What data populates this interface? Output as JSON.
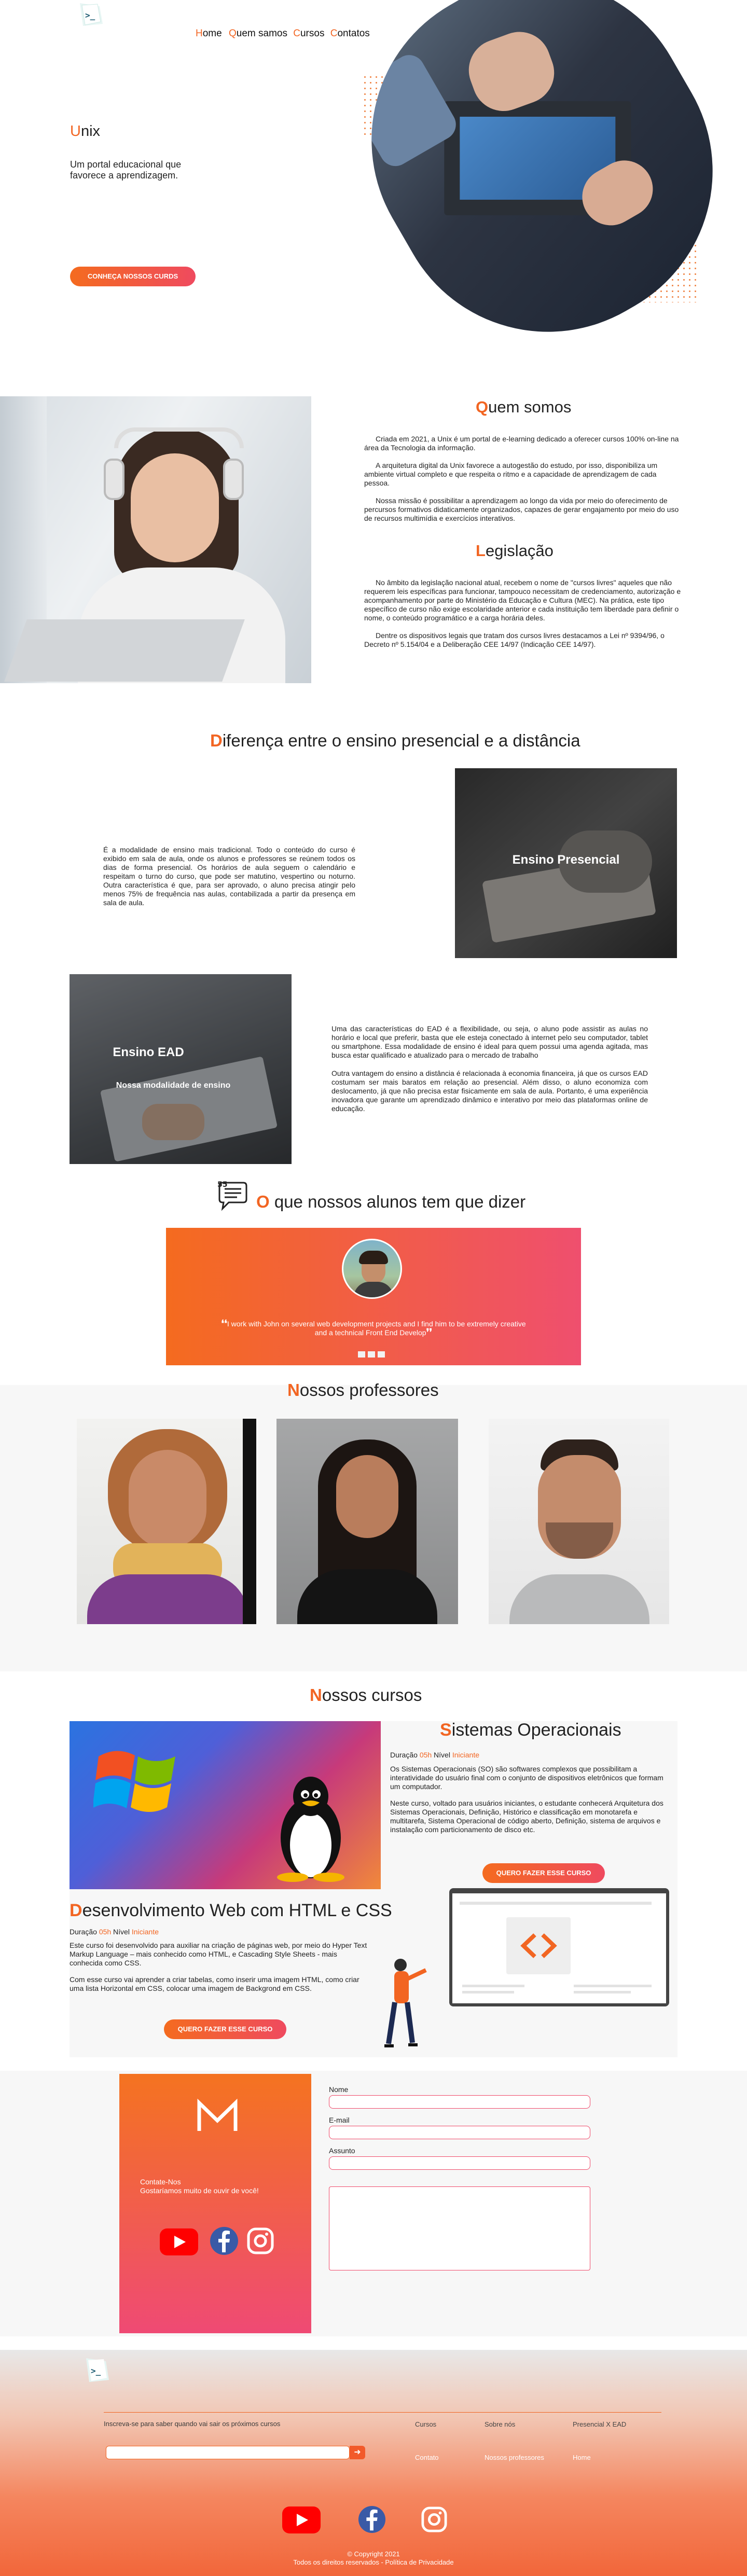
{
  "brand": {
    "logo_glyph": ">_",
    "accent": "#f26522",
    "accent2": "#ef4a6a"
  },
  "nav": {
    "home": "Home",
    "about": "Quem samos",
    "courses": "Cursos",
    "contacts": "Contatos"
  },
  "hero": {
    "title_first": "U",
    "title_rest": "nix",
    "subtitle": "Um portal educacional que favorece a aprendizagem.",
    "cta": "CONHEÇA NOSSOS CURDS"
  },
  "about": {
    "title_first": "Q",
    "title_rest": "uem somos",
    "p1": "Criada em 2021, a Unix é um portal de e-learning dedicado a oferecer cursos 100% on-line na  área da Tecnologia da informação.",
    "p2": "A arquitetura digital da Unix favorece a autogestão do estudo, por isso, disponibiliza um ambiente virtual completo e que respeita o ritmo e a capacidade de aprendizagem de cada pessoa.",
    "p3": "Nossa missão é possibilitar a aprendizagem ao longo da vida por meio do oferecimento de percursos formativos didaticamente organizados, capazes de gerar engajamento por meio do uso de recursos multimídia e exercícios interativos.",
    "legal_first": "L",
    "legal_rest": "egislação",
    "p4": "No âmbito da legislação nacional atual, recebem o nome de \"cursos livres\" aqueles que não requerem leis específicas para funcionar, tampouco necessitam de credenciamento, autorização e acompanhamento por parte do Ministério da Educação e Cultura (MEC). Na prática, este tipo específico de curso não exige escolaridade anterior e cada instituição tem liberdade para definir o nome, o conteúdo programático e a carga horária deles.",
    "p5": "Dentre os dispositivos legais que tratam dos cursos livres destacamos a Lei nº 9394/96, o Decreto nº 5.154/04 e a Deliberação CEE 14/97 (Indicação CEE 14/97)."
  },
  "diff": {
    "title_first": "D",
    "title_rest": "iferença entre o ensino presencial e a distância",
    "presencial_text": "É a modalidade de ensino mais tradicional. Todo o conteúdo do curso é exibido em sala de aula, onde os alunos e professores se reúnem todos os dias de forma presencial. Os horários de aula seguem o calendário e respeitam o turno do curso, que pode ser matutino, vespertino ou noturno. Outra característica é que, para ser aprovado, o aluno precisa atingir pelo menos 75% de frequência nas aulas, contabilizada a partir da presença em sala de aula.",
    "presencial_label": "Ensino Presencial",
    "ead_label": "Ensino EAD",
    "ead_sublabel": "Nossa modalidade de ensino",
    "ead_p1": "Uma das características do EAD é a flexibilidade, ou seja, o aluno pode assistir as aulas no horário e local que preferir, basta que ele esteja conectado à internet pelo seu computador, tablet ou smartphone. Essa modalidade de ensino é ideal para quem possui uma agenda agitada, mas busca estar qualificado e atualizado para o mercado de trabalho",
    "ead_p2": "Outra vantagem do ensino a distância é relacionada à economia financeira, já que os cursos EAD costumam ser mais baratos em relação ao presencial. Além disso, o aluno economiza com deslocamento, já que não precisa estar fisicamente em sala de aula. Portanto, é uma experiência inovadora que garante um aprendizado dinâmico e interativo por meio das plataformas online de educação."
  },
  "testimonials": {
    "title_first": "O",
    "title_rest": " que nossos alunos tem que dizer",
    "quote": "I work with John on several web development projects and I find him to be extremely creative and a technical Front End Develop"
  },
  "teachers": {
    "title_first": "N",
    "title_rest": "ossos professores"
  },
  "courses": {
    "title_first": "N",
    "title_rest": "ossos cursos",
    "so": {
      "title_first": "S",
      "title_rest": "istemas Operacionais",
      "duration_label": "Duração ",
      "duration_value": "05h",
      "level_label": " Nível ",
      "level_value": "Iniciante",
      "p1": "Os Sistemas Operacionais (SO) são softwares complexos que possibilitam a interatividade do usuário final com o conjunto de dispositivos eletrônicos que formam um computador.",
      "p2": "Neste curso, voltado para usuários iniciantes, o estudante conhecerá Arquitetura dos Sistemas Operacionais, Definição, Histórico e classificação em monotarefa  e multitarefa, Sistema Operacional de código aberto, Definição, sistema de arquivos e instalação com  particionamento de disco etc.",
      "cta": "QUERO FAZER ESSE CURSO"
    },
    "web": {
      "title_first": "D",
      "title_rest": "esenvolvimento Web com HTML e CSS",
      "duration_label": "Duração ",
      "duration_value": "05h",
      "level_label": " Nível ",
      "level_value": "Iniciante",
      "p1": "Este curso foi desenvolvido para auxiliar na criação de páginas web, por meio do Hyper Text Markup Language – mais conhecido como HTML, e Cascading Style Sheets - mais conhecida como CSS.",
      "p2": "Com esse curso vai aprender a criar tabelas,  como inserir uma imagem HTML, como criar uma lista Horizontal em CSS, colocar uma imagem de Backgrond em CSS.",
      "cta": "QUERO FAZER ESSE CURSO"
    }
  },
  "contact": {
    "tagline1": "Contate-Nos",
    "tagline2": "Gostaríamos muito de ouvir de você!",
    "name_label": "Nome",
    "email_label": "E-mail",
    "subject_label": "Assunto"
  },
  "footer": {
    "newsletter": "Inscreva-se para saber quando vai sair os próximos cursos",
    "links": {
      "cursos": "Cursos",
      "sobre": "Sobre nós",
      "presencial": "Presencial X EAD",
      "contato": "Contato",
      "professores": "Nossos professores",
      "home": "Home"
    },
    "copyright": "© Copyright 2021",
    "rights": "Todos os direitos reservados - Política de Privacidade"
  }
}
